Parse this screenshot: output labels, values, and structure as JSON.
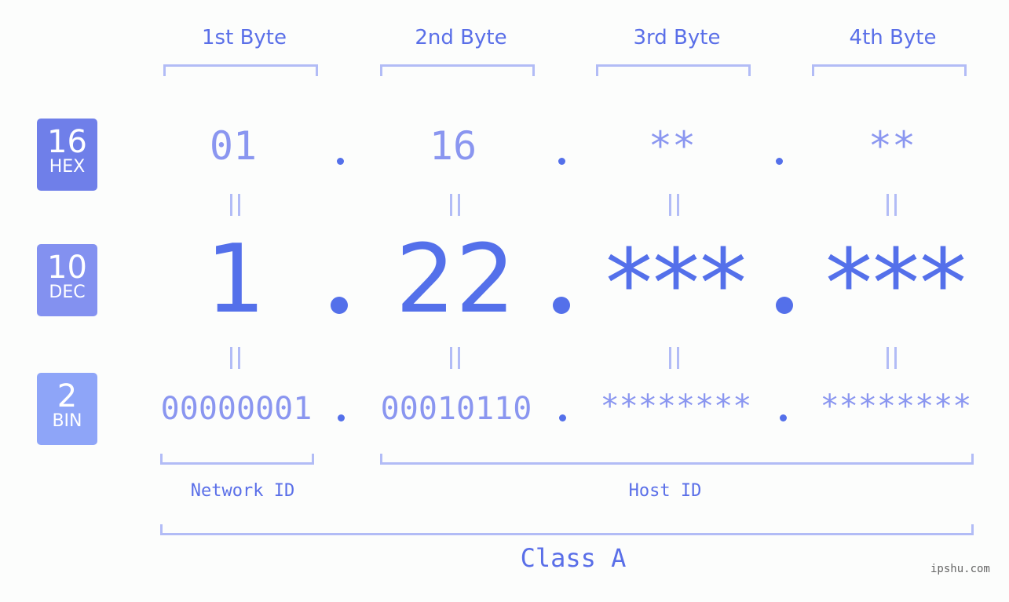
{
  "colors": {
    "hex_badge": "#6f7fe9",
    "dec_badge": "#8391f0",
    "bin_badge": "#8ea5f8",
    "accent": "#5470ea",
    "light_text": "#8a96f0",
    "bracket": "#b2bcf6"
  },
  "badges": [
    {
      "number": "16",
      "label": "HEX"
    },
    {
      "number": "10",
      "label": "DEC"
    },
    {
      "number": "2",
      "label": "BIN"
    }
  ],
  "byte_headers": [
    "1st Byte",
    "2nd Byte",
    "3rd Byte",
    "4th Byte"
  ],
  "hex_values": [
    "01",
    "16",
    "**",
    "**"
  ],
  "dec_values": [
    "1",
    "22",
    "***",
    "***"
  ],
  "bin_values": [
    "00000001",
    "00010110",
    "********",
    "********"
  ],
  "network_label": "Network ID",
  "host_label": "Host ID",
  "class_label": "Class A",
  "watermark": "ipshu.com"
}
